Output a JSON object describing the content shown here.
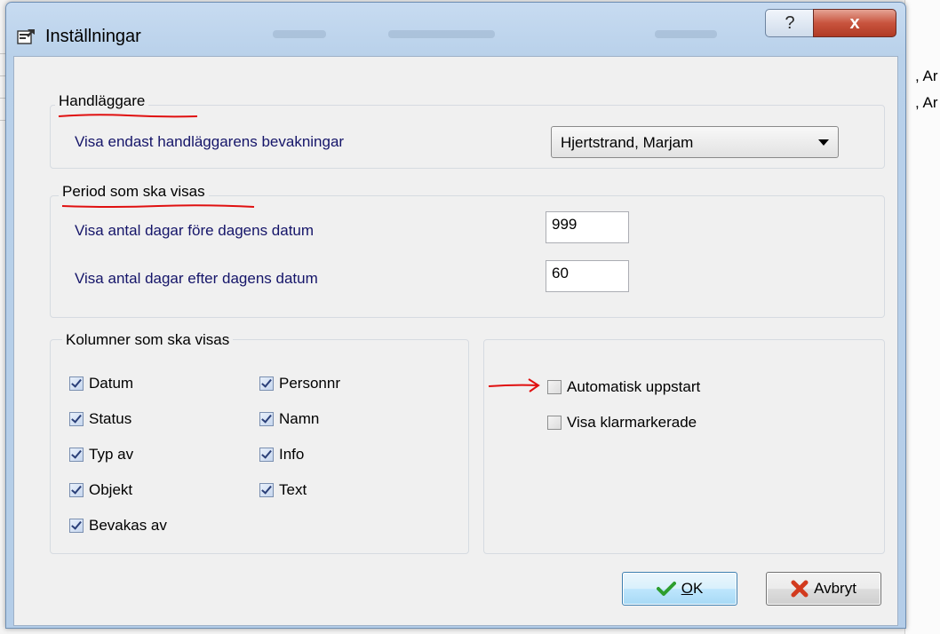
{
  "window": {
    "title": "Inställningar",
    "help_glyph": "?",
    "close_glyph": "x"
  },
  "background": {
    "row1": ", Ar",
    "row2": ", Ar"
  },
  "handlaggare": {
    "group_label": "Handläggare",
    "label": "Visa endast handläggarens bevakningar",
    "selected": "Hjertstrand, Marjam"
  },
  "period": {
    "group_label": "Period som ska visas",
    "before_label": "Visa antal dagar före dagens datum",
    "before_value": "999",
    "after_label": "Visa antal dagar efter dagens datum",
    "after_value": "60"
  },
  "columns": {
    "group_label": "Kolumner som ska visas",
    "items": [
      {
        "label": "Datum",
        "checked": true
      },
      {
        "label": "Status",
        "checked": true
      },
      {
        "label": "Typ av",
        "checked": true
      },
      {
        "label": "Objekt",
        "checked": true
      },
      {
        "label": "Bevakas av",
        "checked": true
      },
      {
        "label": "Personnr",
        "checked": true
      },
      {
        "label": "Namn",
        "checked": true
      },
      {
        "label": "Info",
        "checked": true
      },
      {
        "label": "Text",
        "checked": true
      }
    ]
  },
  "options": {
    "items": [
      {
        "label": "Automatisk uppstart",
        "checked": false
      },
      {
        "label": "Visa klarmarkerade",
        "checked": false
      }
    ]
  },
  "buttons": {
    "ok": "OK",
    "cancel": "Avbryt"
  },
  "colors": {
    "annotation": "#e01010",
    "label_blue": "#151569"
  }
}
